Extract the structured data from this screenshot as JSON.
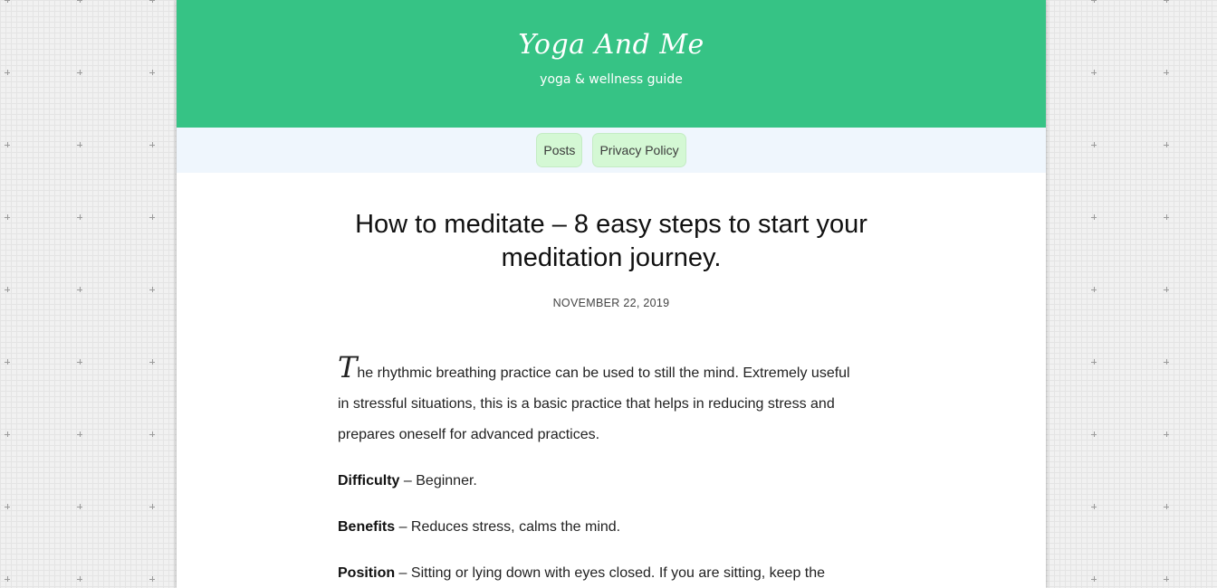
{
  "site": {
    "title": "Yoga And Me",
    "tagline": "yoga & wellness guide"
  },
  "nav": {
    "items": [
      "Posts",
      "Privacy Policy"
    ]
  },
  "post": {
    "title": "How to meditate – 8 easy steps to start your meditation journey.",
    "date": "NOVEMBER 22, 2019",
    "intro_dropcap": "T",
    "intro_rest": "he rhythmic breathing practice can be used to still the mind. Extremely useful in stressful situations, this is a basic practice that helps in reducing stress and prepares oneself for advanced practices.",
    "difficulty_label": "Difficulty",
    "difficulty_text": " – Beginner.",
    "benefits_label": "Benefits",
    "benefits_text": " – Reduces stress, calms the mind.",
    "position_label": "Position",
    "position_text": " – Sitting or lying down with eyes closed. If you are sitting, keep the"
  },
  "colors": {
    "header_bg": "#36c385",
    "nav_bg": "#eff6fd",
    "nav_button_bg": "#d4f8d4",
    "page_bg": "#f1f1f1"
  }
}
